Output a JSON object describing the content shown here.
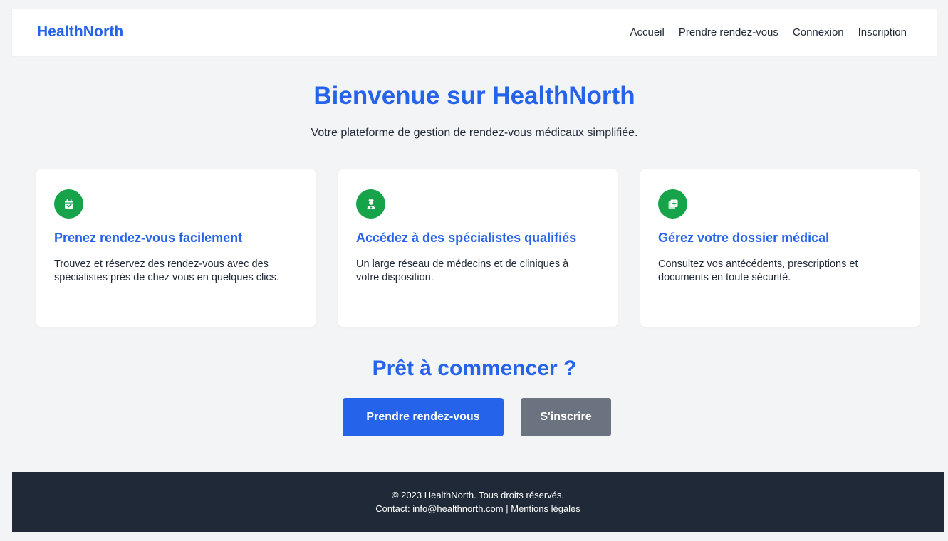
{
  "header": {
    "logo": "HealthNorth",
    "nav": [
      {
        "label": "Accueil"
      },
      {
        "label": "Prendre rendez-vous"
      },
      {
        "label": "Connexion"
      },
      {
        "label": "Inscription"
      }
    ]
  },
  "hero": {
    "title": "Bienvenue sur HealthNorth",
    "subtitle": "Votre plateforme de gestion de rendez-vous médicaux simplifiée."
  },
  "features": [
    {
      "icon": "calendar-check-icon",
      "title": "Prenez rendez-vous facilement",
      "text": "Trouvez et réservez des rendez-vous avec des spécialistes près de chez vous en quelques clics."
    },
    {
      "icon": "doctor-icon",
      "title": "Accédez à des spécialistes qualifiés",
      "text": "Un large réseau de médecins et de cliniques à votre disposition."
    },
    {
      "icon": "medical-file-icon",
      "title": "Gérez votre dossier médical",
      "text": "Consultez vos antécédents, prescriptions et documents en toute sécurité."
    }
  ],
  "cta": {
    "title": "Prêt à commencer ?",
    "primary_label": "Prendre rendez-vous",
    "secondary_label": "S'inscrire"
  },
  "footer": {
    "copyright": "© 2023 HealthNorth. Tous droits réservés.",
    "contact_prefix": "Contact: ",
    "email": "info@healthnorth.com",
    "separator": " | ",
    "legal_link": "Mentions légales"
  },
  "colors": {
    "accent": "#2563eb",
    "icon_bg": "#16a34a",
    "secondary_button": "#6b7280",
    "footer_bg": "#1f2937",
    "page_bg": "#f3f4f6"
  }
}
